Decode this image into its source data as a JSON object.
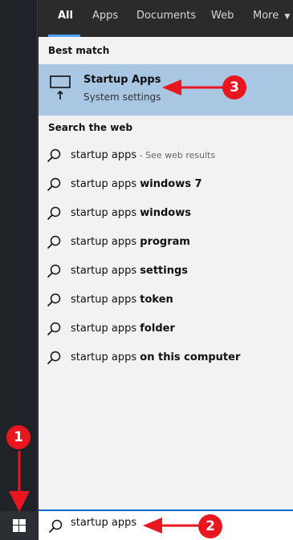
{
  "tabs": [
    {
      "label": "All",
      "active": true
    },
    {
      "label": "Apps"
    },
    {
      "label": "Documents"
    },
    {
      "label": "Web"
    },
    {
      "label": "More"
    }
  ],
  "best_match": {
    "heading": "Best match",
    "title": "Startup Apps",
    "subtitle": "System settings",
    "icon": "startup-apps-icon"
  },
  "web": {
    "heading": "Search the web",
    "results": [
      {
        "query": "startup apps",
        "suffix": "",
        "hint": " - See web results"
      },
      {
        "query": "startup apps ",
        "suffix": "windows 7",
        "hint": ""
      },
      {
        "query": "startup apps ",
        "suffix": "windows",
        "hint": ""
      },
      {
        "query": "startup apps ",
        "suffix": "program",
        "hint": ""
      },
      {
        "query": "startup apps ",
        "suffix": "settings",
        "hint": ""
      },
      {
        "query": "startup apps ",
        "suffix": "token",
        "hint": ""
      },
      {
        "query": "startup apps ",
        "suffix": "folder",
        "hint": ""
      },
      {
        "query": "startup apps ",
        "suffix": "on this computer",
        "hint": ""
      }
    ]
  },
  "search": {
    "value": "startup apps"
  },
  "annotations": {
    "badge1": "1",
    "badge2": "2",
    "badge3": "3"
  },
  "colors": {
    "accent": "#4ea0ff",
    "highlight": "#a9c6e2",
    "annotation": "#e8171f"
  }
}
